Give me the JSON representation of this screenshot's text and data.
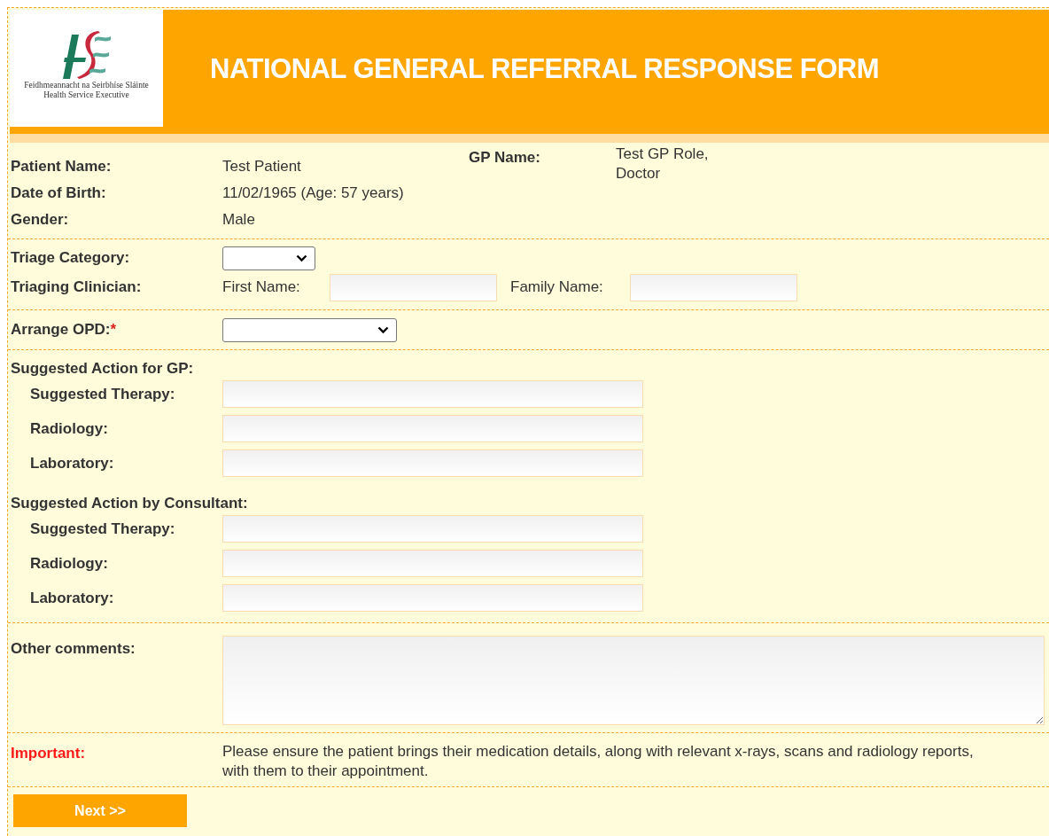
{
  "header": {
    "title": "NATIONAL GENERAL REFERRAL RESPONSE FORM",
    "logo_lines": [
      "Feidhmeannacht na Seirbhíse Sláinte",
      "Health Service Executive"
    ]
  },
  "patient": [
    {
      "label": "Patient Name:",
      "value": "Test Patient"
    },
    {
      "label": "Date of Birth:",
      "value": "11/02/1965 (Age: 57 years)"
    },
    {
      "label": "Gender:",
      "value": "Male"
    }
  ],
  "gp": {
    "label": "GP Name:",
    "value_lines": [
      "Test GP Role,",
      "Doctor"
    ]
  },
  "triage": {
    "category_label": "Triage Category:",
    "clinician_label": "Triaging Clinician:",
    "first_name_label": "First Name:",
    "family_name_label": "Family Name:"
  },
  "arrange_opd": {
    "label": "Arrange OPD:",
    "required": true,
    "required_mark": "*"
  },
  "sections": [
    {
      "heading": "Suggested Action for GP:",
      "fields": [
        "Suggested Therapy:",
        "Radiology:",
        "Laboratory:"
      ]
    },
    {
      "heading": "Suggested Action by Consultant:",
      "fields": [
        "Suggested Therapy:",
        "Radiology:",
        "Laboratory:"
      ]
    }
  ],
  "comments": {
    "label": "Other comments:"
  },
  "important": {
    "label": "Important:",
    "text": "Please ensure the patient brings their medication details, along with relevant x-rays, scans and radiology reports, with them to their appointment."
  },
  "next_button": "Next >>"
}
